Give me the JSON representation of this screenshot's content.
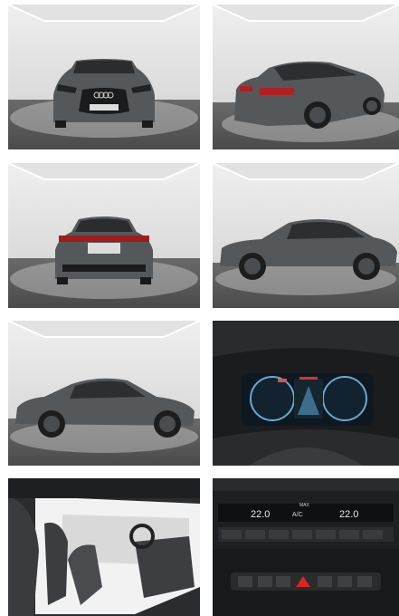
{
  "gallery": {
    "photos": [
      {
        "subject": "studio-front-view",
        "body_color": "#5a5d60"
      },
      {
        "subject": "studio-rear-three-quarter-view",
        "body_color": "#5a5d60"
      },
      {
        "subject": "studio-rear-view",
        "body_color": "#5a5d60"
      },
      {
        "subject": "studio-side-view-right",
        "body_color": "#5a5d60"
      },
      {
        "subject": "studio-side-view-left",
        "body_color": "#5a5d60"
      },
      {
        "subject": "digital-instrument-cluster",
        "body_color": "#1b1c1e"
      },
      {
        "subject": "front-seats-interior",
        "body_color": "#2b2c2e"
      },
      {
        "subject": "climate-control-panel",
        "body_color": "#1e1f21"
      }
    ],
    "climate": {
      "left_temp": "22.0",
      "right_temp": "22.0",
      "mode_label": "A/C",
      "max_label": "MAX"
    }
  }
}
